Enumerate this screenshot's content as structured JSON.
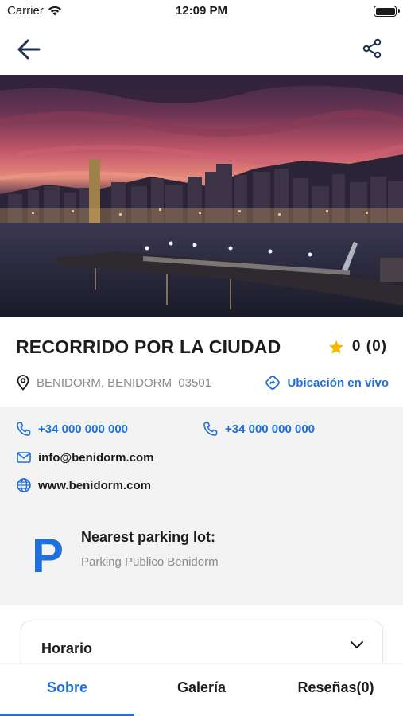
{
  "status": {
    "carrier": "Carrier",
    "time": "12:09 PM"
  },
  "place": {
    "title": "RECORRIDO POR LA CIUDAD",
    "rating": "0 (0)",
    "location": "BENIDORM, BENIDORM  03501",
    "live_location_label": "Ubicación en vivo"
  },
  "contact": {
    "phone1": "+34 000 000 000",
    "phone2": "+34 000 000 000",
    "email": "info@benidorm.com",
    "website": "www.benidorm.com"
  },
  "parking": {
    "symbol": "P",
    "title": "Nearest parking lot:",
    "name": "Parking Publico Benidorm"
  },
  "schedule": {
    "label": "Horario"
  },
  "tabs": [
    {
      "label": "Sobre",
      "active": true
    },
    {
      "label": "Galería",
      "active": false
    },
    {
      "label": "Reseñas(0)",
      "active": false
    }
  ],
  "colors": {
    "accent": "#1f6fdc",
    "star": "#f5b800",
    "muted": "#8a8a8e",
    "panel": "#f3f3f4"
  }
}
